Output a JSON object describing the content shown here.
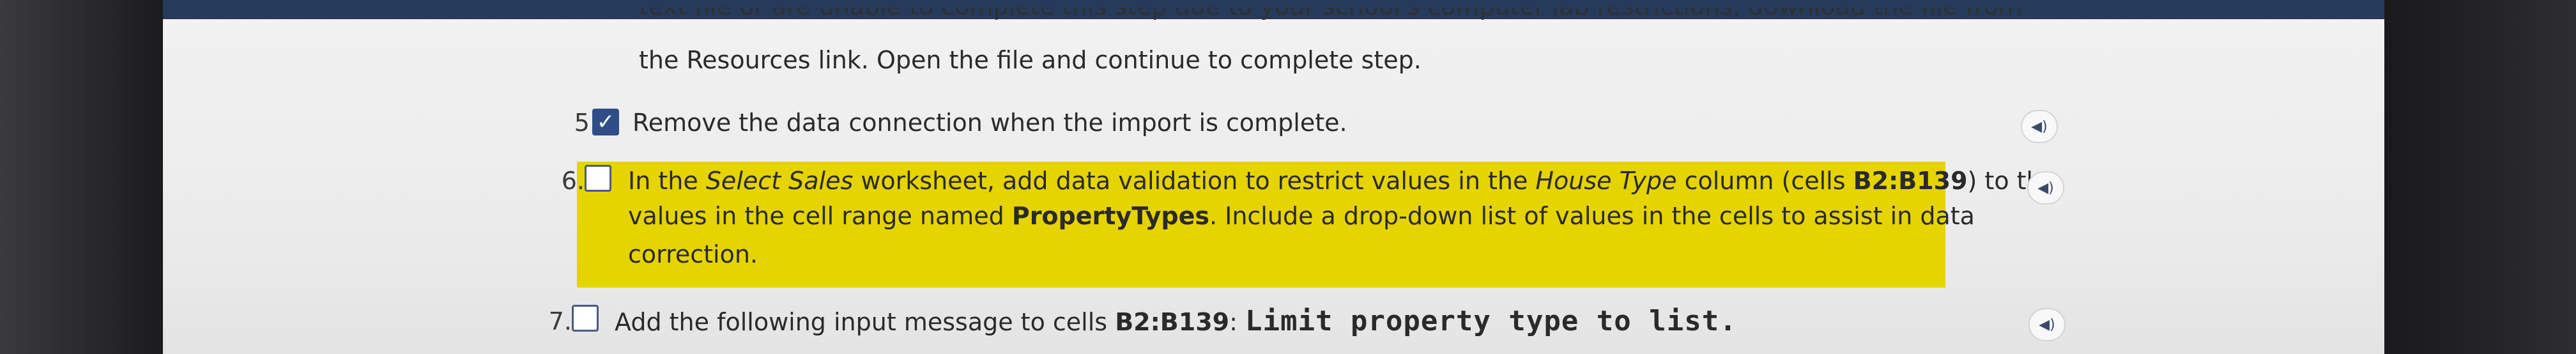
{
  "header": {
    "partial_text": "text file or are unable to complete this step due to your school's computer lab restrictions, download the file from"
  },
  "intro": {
    "line2": "the Resources link. Open the file and continue to complete step."
  },
  "steps": [
    {
      "number": "5.",
      "checked": true,
      "text": "Remove the data connection when the import is complete."
    },
    {
      "number": "6.",
      "checked": false,
      "highlighted": true,
      "line1": {
        "t1": "In the ",
        "t2": "Select Sales",
        "t3": " worksheet, add data validation to restrict values in the ",
        "t4": "House Type",
        "t5": " column (cells ",
        "t6": "B2:B139",
        "t7": ") to the"
      },
      "line2": {
        "t1": "values in the cell range named ",
        "t2": "PropertyTypes",
        "t3": ". Include a drop-down list of values in the cells to assist in data"
      },
      "line3": "correction."
    },
    {
      "number": "7.",
      "checked": false,
      "t1": "Add the following input message to cells ",
      "t2": "B2:B139",
      "t3": ":",
      "code": "Limit property type to list."
    }
  ],
  "audio": {
    "icon": "speaker-icon",
    "glyph": "◀︎)"
  },
  "colors": {
    "highlight": "#e5d400",
    "top_bar": "#263a5c",
    "checkbox_checked": "#2f4d86"
  }
}
